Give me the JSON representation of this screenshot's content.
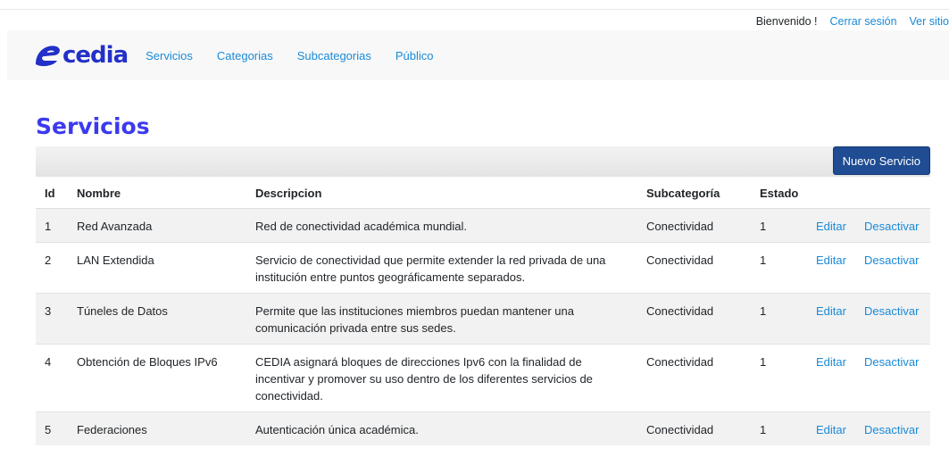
{
  "header": {
    "welcome": "Bienvenido !",
    "logout": "Cerrar sesión",
    "view_site": "Ver sitio"
  },
  "nav": {
    "logo": "cedia",
    "links": [
      "Servicios",
      "Categorias",
      "Subcategorias",
      "Público"
    ]
  },
  "page": {
    "title": "Servicios",
    "new_button": "Nuevo Servicio"
  },
  "table": {
    "columns": [
      "Id",
      "Nombre",
      "Descripcion",
      "Subcategoría",
      "Estado"
    ],
    "rows": [
      {
        "id": "1",
        "nombre": "Red Avanzada",
        "descripcion": "Red de conectividad académica mundial.",
        "subcategoria": "Conectividad",
        "estado": "1",
        "editar": "Editar",
        "desactivar": "Desactivar"
      },
      {
        "id": "2",
        "nombre": "LAN Extendida",
        "descripcion": "Servicio de conectividad que permite extender la red privada de una institución entre puntos geográficamente separados.",
        "subcategoria": "Conectividad",
        "estado": "1",
        "editar": "Editar",
        "desactivar": "Desactivar"
      },
      {
        "id": "3",
        "nombre": "Túneles de Datos",
        "descripcion": "Permite que las instituciones miembros puedan mantener una comunicación privada entre sus sedes.",
        "subcategoria": "Conectividad",
        "estado": "1",
        "editar": "Editar",
        "desactivar": "Desactivar"
      },
      {
        "id": "4",
        "nombre": "Obtención de Bloques IPv6",
        "descripcion": "CEDIA asignará bloques de direcciones Ipv6 con la finalidad de incentivar y promover su uso dentro de los diferentes servicios de conectividad.",
        "subcategoria": "Conectividad",
        "estado": "1",
        "editar": "Editar",
        "desactivar": "Desactivar"
      },
      {
        "id": "5",
        "nombre": "Federaciones",
        "descripcion": "Autenticación única académica.",
        "subcategoria": "Conectividad",
        "estado": "1",
        "editar": "Editar",
        "desactivar": "Desactivar"
      }
    ]
  }
}
